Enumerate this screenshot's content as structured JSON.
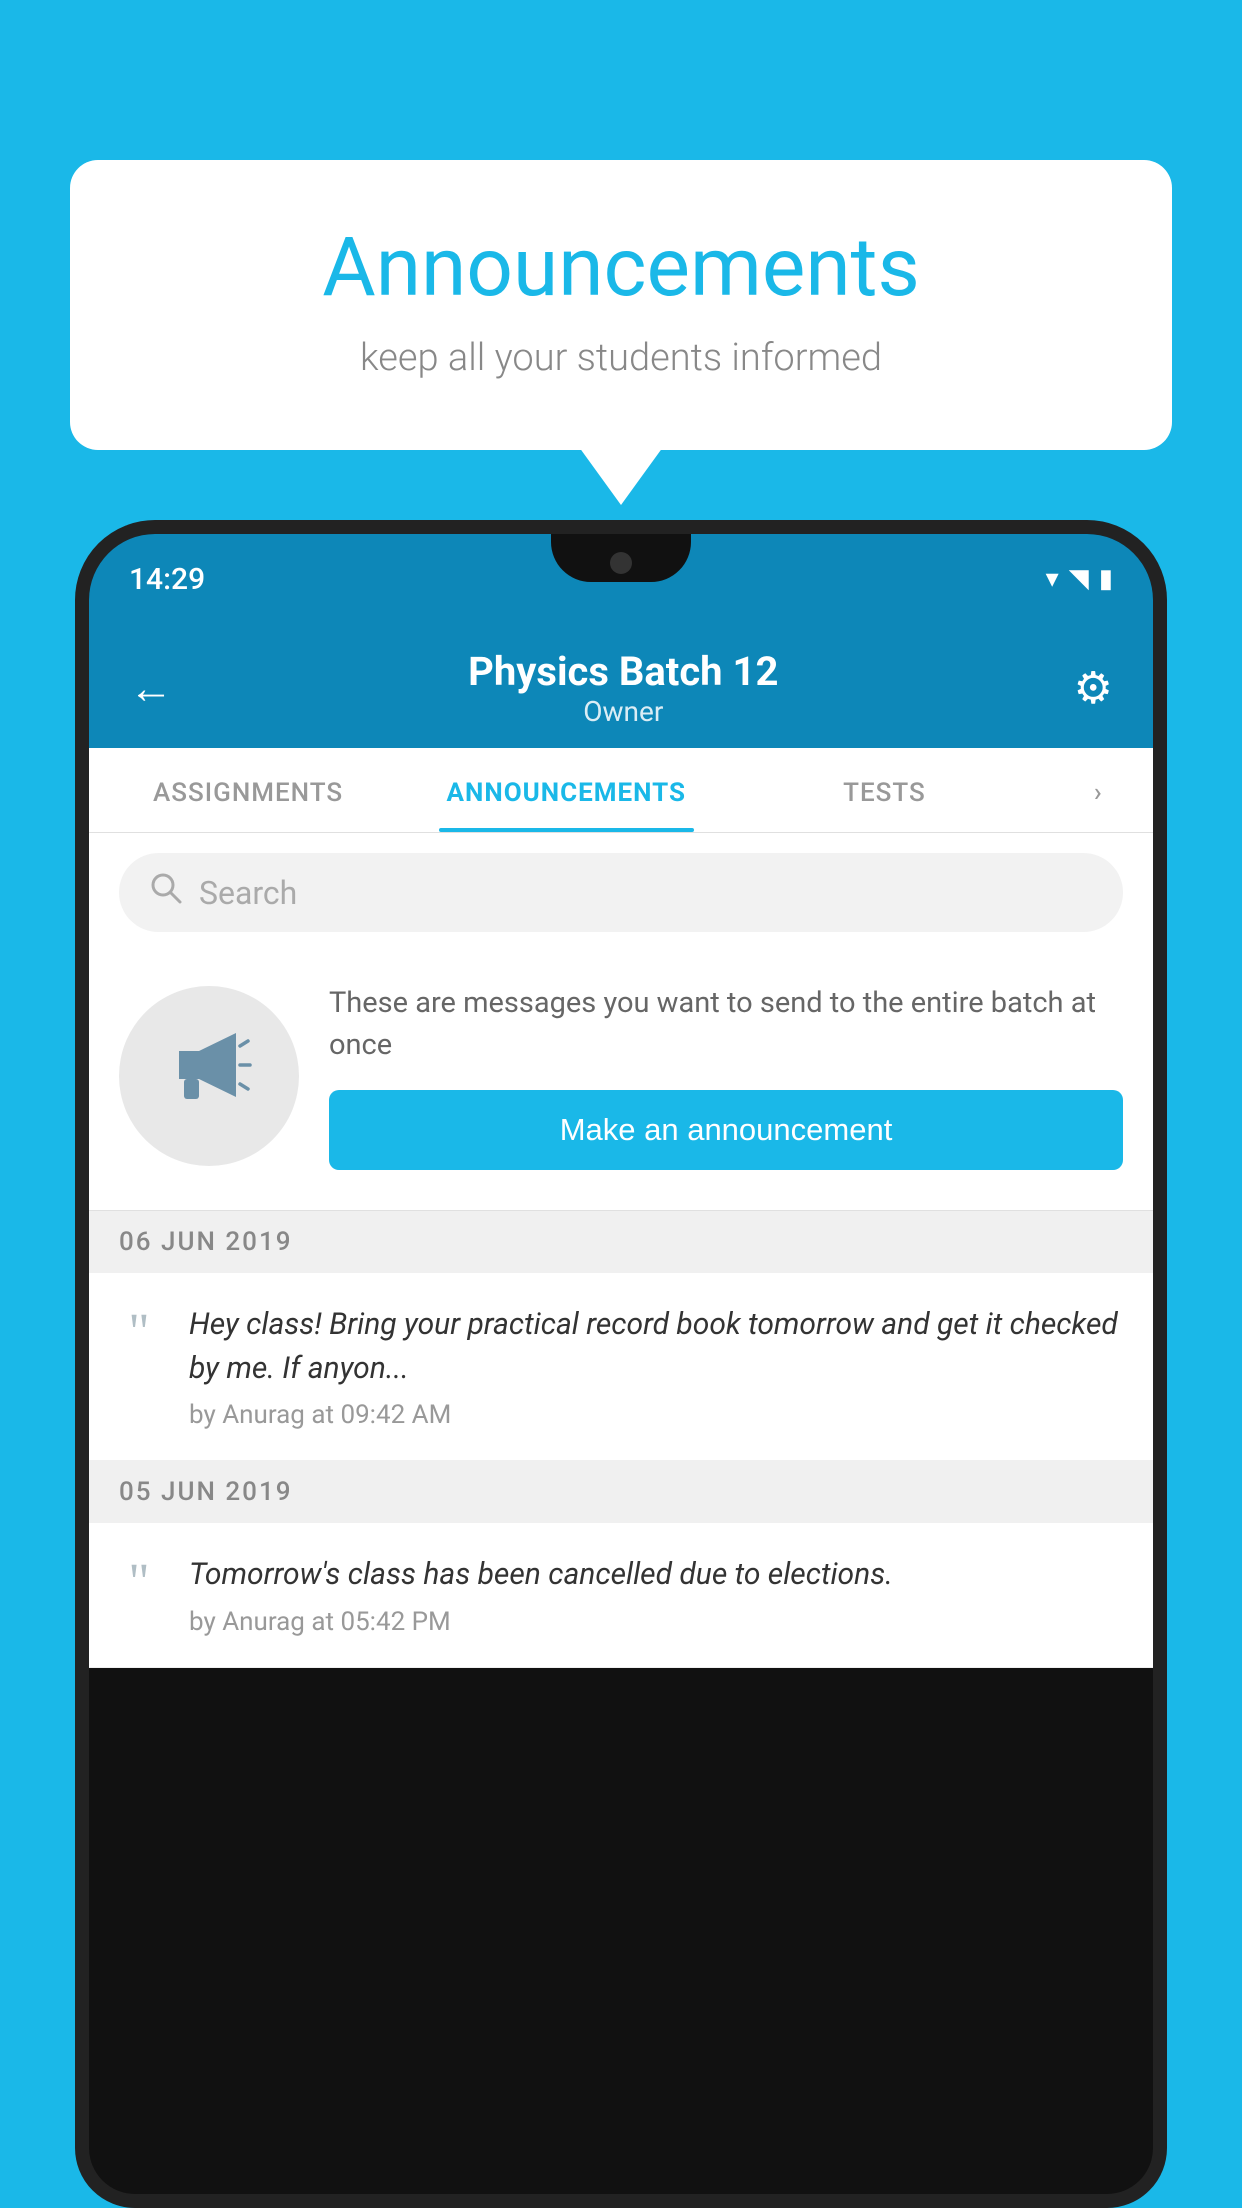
{
  "background_color": "#1ab8e8",
  "speech_bubble": {
    "title": "Announcements",
    "subtitle": "keep all your students informed"
  },
  "phone": {
    "status_bar": {
      "time": "14:29",
      "wifi": "▼",
      "signal": "▲",
      "battery": "▉"
    },
    "header": {
      "back_label": "←",
      "title": "Physics Batch 12",
      "subtitle": "Owner",
      "gear_label": "⚙"
    },
    "tabs": [
      {
        "label": "ASSIGNMENTS",
        "active": false
      },
      {
        "label": "ANNOUNCEMENTS",
        "active": true
      },
      {
        "label": "TESTS",
        "active": false
      },
      {
        "label": "›",
        "active": false
      }
    ],
    "search": {
      "placeholder": "Search"
    },
    "promo": {
      "description": "These are messages you want to send to the entire batch at once",
      "button_label": "Make an announcement"
    },
    "announcements": [
      {
        "date": "06  JUN  2019",
        "message": "Hey class! Bring your practical record book tomorrow and get it checked by me. If anyon...",
        "meta": "by Anurag at 09:42 AM"
      },
      {
        "date": "05  JUN  2019",
        "message": "Tomorrow's class has been cancelled due to elections.",
        "meta": "by Anurag at 05:42 PM"
      }
    ]
  }
}
